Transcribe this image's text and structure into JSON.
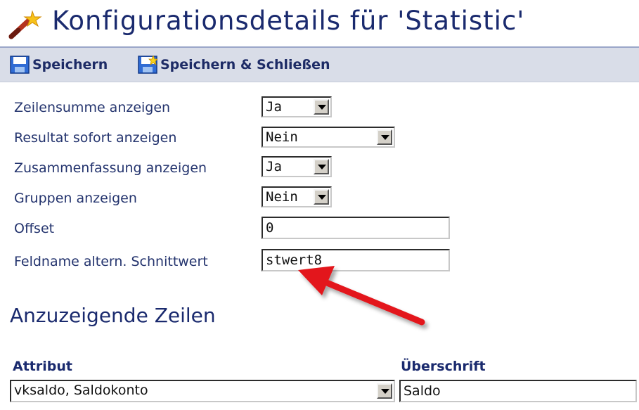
{
  "header": {
    "title": "Konfigurationsdetails für 'Statistic'",
    "icon": "magic-wand-icon"
  },
  "toolbar": {
    "save_label": "Speichern",
    "save_close_label": "Speichern & Schließen",
    "save_icon": "floppy-disk-icon",
    "save_close_icon": "floppy-disk-star-icon"
  },
  "form": {
    "rows": [
      {
        "label": "Zeilensumme anzeigen",
        "type": "select",
        "value": "Ja"
      },
      {
        "label": "Resultat sofort anzeigen",
        "type": "select",
        "value": "Nein"
      },
      {
        "label": "Zusammenfassung anzeigen",
        "type": "select",
        "value": "Ja"
      },
      {
        "label": "Gruppen anzeigen",
        "type": "select",
        "value": "Nein"
      },
      {
        "label": "Offset",
        "type": "input",
        "value": "0"
      },
      {
        "label": "Feldname altern. Schnittwert",
        "type": "input",
        "value": "stwert8"
      }
    ]
  },
  "section": {
    "title": "Anzuzeigende Zeilen",
    "columns": {
      "attribut": "Attribut",
      "ueberschrift": "Überschrift"
    },
    "row": {
      "attribut": "vksaldo, Saldokonto",
      "ueberschrift": "Saldo"
    }
  },
  "annotation": {
    "arrow_color": "#e3181b"
  }
}
